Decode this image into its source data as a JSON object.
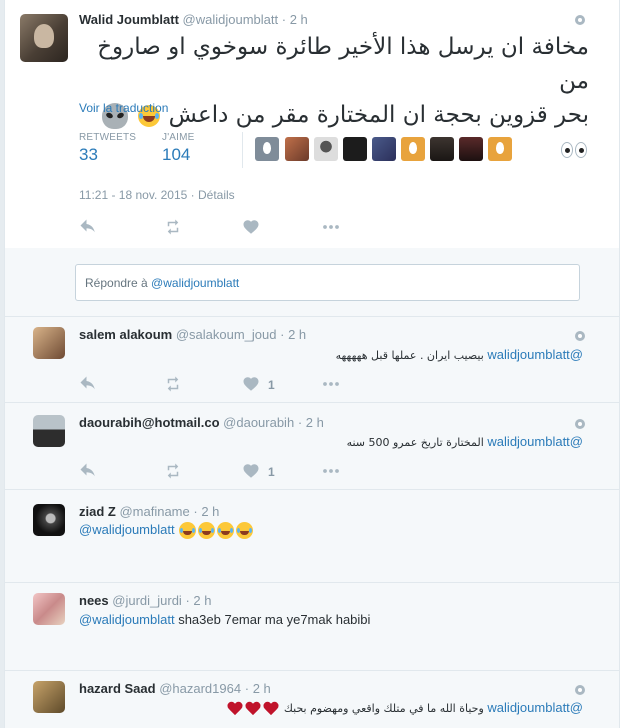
{
  "main_tweet": {
    "fullname": "Walid Joumblatt",
    "handle": "@walidjoumblatt",
    "time": "2 h",
    "text_line1": "مخافة ان يرسل هذا الأخير طائرة سوخوي او صاروخ من",
    "text_line2": "بحر قزوين بحجة ان المختارة مقر من داعش",
    "emoji_icons": [
      "laughing-crying-emoji",
      "alien-emoji",
      "eyes-emoji"
    ],
    "translate_label": "Voir la traduction",
    "retweets_label": "RETWEETS",
    "retweets_count": "33",
    "likes_label": "J'AIME",
    "likes_count": "104",
    "timestamp": "11:21 - 18 nov. 2015",
    "details_label": "Détails"
  },
  "reply_box": {
    "prefix": "Répondre à ",
    "mention": "@walidjoumblatt"
  },
  "replies": [
    {
      "fullname": "salem alakoum",
      "handle": "@salakoum_joud",
      "time": "2 h",
      "mention": "@walidjoumblatt",
      "text": "بيصيب ايران . عملها قبل هههههه",
      "like_count": "1"
    },
    {
      "fullname": "daourabih@hotmail.co",
      "handle": "@daourabih",
      "time": "2 h",
      "mention": "@walidjoumblatt",
      "text": "المختارة تاريخ عمرو 500 سنه",
      "like_count": "1"
    },
    {
      "fullname": "ziad Z",
      "handle": "@mafiname",
      "time": "2 h",
      "mention": "@walidjoumblatt",
      "text": "",
      "emoji_count": 4
    },
    {
      "fullname": "nees",
      "handle": "@jurdi_jurdi",
      "time": "2 h",
      "mention": "@walidjoumblatt",
      "text": "sha3eb 7emar ma ye7mak habibi"
    },
    {
      "fullname": "hazard Saad",
      "handle": "@hazard1964",
      "time": "2 h",
      "mention": "@walidjoumblatt",
      "text": "وحياة الله ما في متلك واقعي ومهضوم بحبك"
    }
  ],
  "colors": {
    "link": "#2b7bb9",
    "muted": "#8899a6",
    "icon": "#aab8c2",
    "background": "#e6ecf0"
  }
}
